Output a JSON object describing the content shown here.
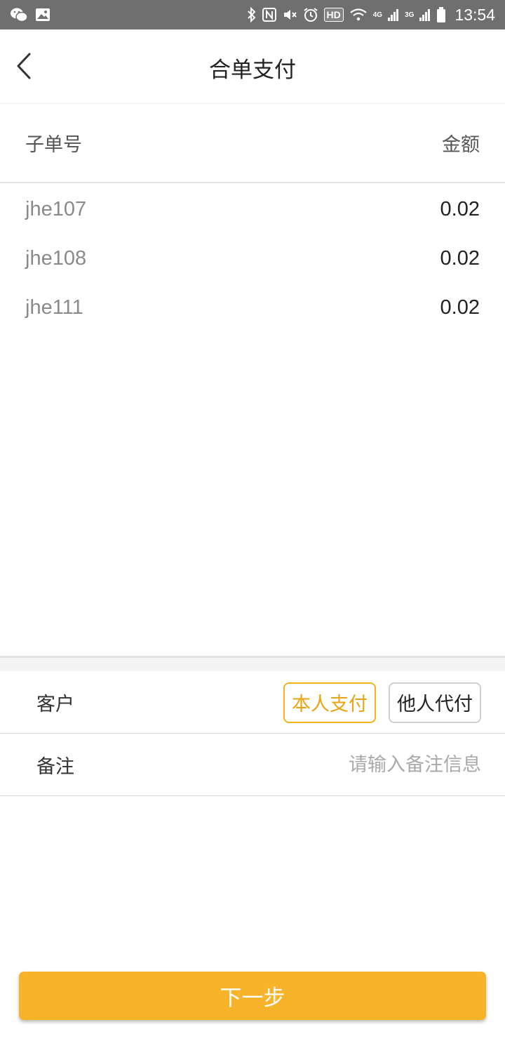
{
  "status_bar": {
    "time": "13:54",
    "hd": "HD",
    "net1": "4G",
    "net2": "3G",
    "icons": [
      "wechat-icon",
      "image-icon",
      "bluetooth-icon",
      "nfc-icon",
      "mute-icon",
      "alarm-icon",
      "wifi-icon",
      "signal-icon",
      "battery-icon"
    ]
  },
  "header": {
    "title": "合单支付",
    "back_icon": "chevron-left-icon"
  },
  "table": {
    "col_order": "子单号",
    "col_amount": "金额",
    "rows": [
      {
        "order_no": "jhe107",
        "amount": "0.02"
      },
      {
        "order_no": "jhe108",
        "amount": "0.02"
      },
      {
        "order_no": "jhe111",
        "amount": "0.02"
      }
    ]
  },
  "form": {
    "customer_label": "客户",
    "self_pay": "本人支付",
    "other_pay": "他人代付",
    "remark_label": "备注",
    "remark_placeholder": "请输入备注信息",
    "remark_value": ""
  },
  "footer": {
    "next_label": "下一步"
  },
  "colors": {
    "accent": "#f7b32a",
    "accent_text": "#e9a412",
    "status_bar": "#6f6f6f"
  }
}
